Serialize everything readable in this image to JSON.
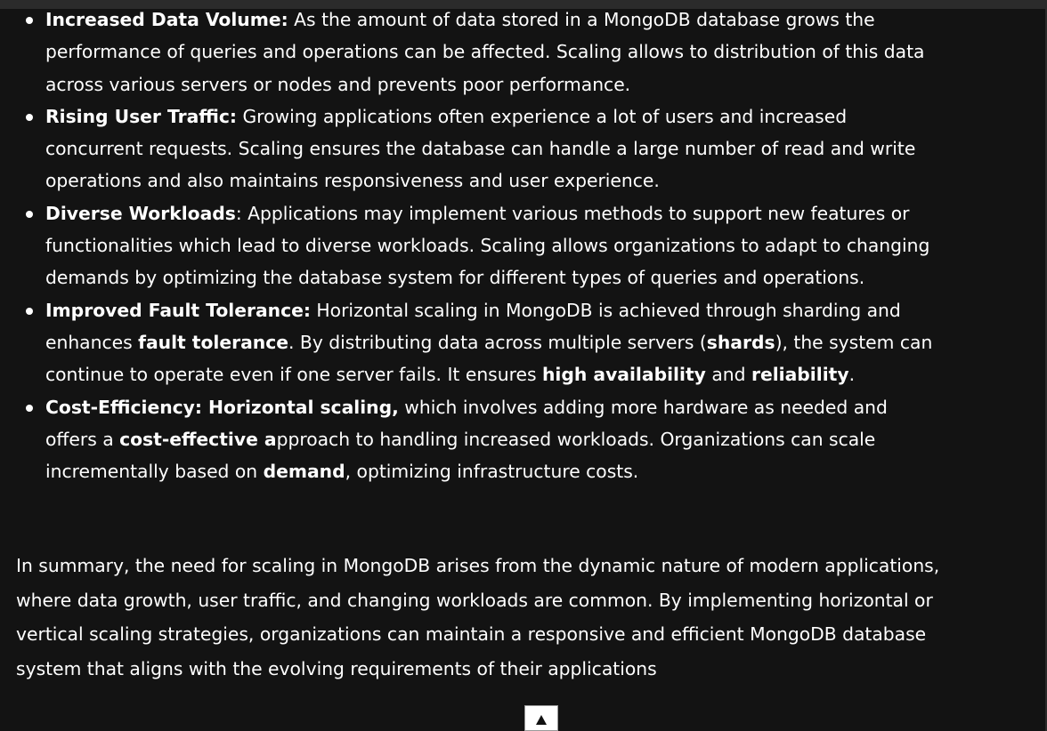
{
  "bullets": [
    {
      "parts": [
        {
          "b": true,
          "t": "Increased Data Volume:"
        },
        {
          "b": false,
          "t": " As the amount of data stored in a MongoDB database grows the performance of queries and operations can be affected. Scaling allows to distribution of this data across various servers or nodes and prevents poor performance."
        }
      ]
    },
    {
      "parts": [
        {
          "b": true,
          "t": "Rising User Traffic:"
        },
        {
          "b": false,
          "t": " Growing applications often experience a lot of users and increased concurrent requests. Scaling ensures the database can handle a large number of read and write operations and also maintains responsiveness and user experience."
        }
      ]
    },
    {
      "parts": [
        {
          "b": true,
          "t": "Diverse Workloads"
        },
        {
          "b": false,
          "t": ": Applications may implement various methods to support new features or functionalities which lead to diverse workloads. Scaling allows organizations to adapt to changing demands by optimizing the database system for different types of queries and operations."
        }
      ]
    },
    {
      "parts": [
        {
          "b": true,
          "t": "Improved Fault Tolerance:"
        },
        {
          "b": false,
          "t": " Horizontal scaling in MongoDB is achieved through sharding and enhances "
        },
        {
          "b": true,
          "t": "fault tolerance"
        },
        {
          "b": false,
          "t": ". By distributing data across multiple servers ("
        },
        {
          "b": true,
          "t": "shards"
        },
        {
          "b": false,
          "t": "), the system can continue to operate even if one server fails. It ensures "
        },
        {
          "b": true,
          "t": "high availability"
        },
        {
          "b": false,
          "t": " and "
        },
        {
          "b": true,
          "t": "reliability"
        },
        {
          "b": false,
          "t": "."
        }
      ]
    },
    {
      "parts": [
        {
          "b": true,
          "t": "Cost-Efficiency: Horizontal scaling,"
        },
        {
          "b": false,
          "t": " which involves adding more hardware as needed and offers a "
        },
        {
          "b": true,
          "t": "cost-effective a"
        },
        {
          "b": false,
          "t": "pproach to handling increased workloads. Organizations can scale incrementally based on "
        },
        {
          "b": true,
          "t": "demand"
        },
        {
          "b": false,
          "t": ", optimizing infrastructure costs."
        }
      ]
    }
  ],
  "summary": "In summary, the need for scaling in MongoDB arises from the dynamic nature of modern applications, where data growth, user traffic, and changing workloads are common. By implementing horizontal or vertical scaling strategies, organizations can maintain a responsive and efficient MongoDB database system that aligns with the evolving requirements of their applications",
  "scroll_top": {
    "icon": "▲",
    "icon_name": "arrow-up-icon"
  }
}
